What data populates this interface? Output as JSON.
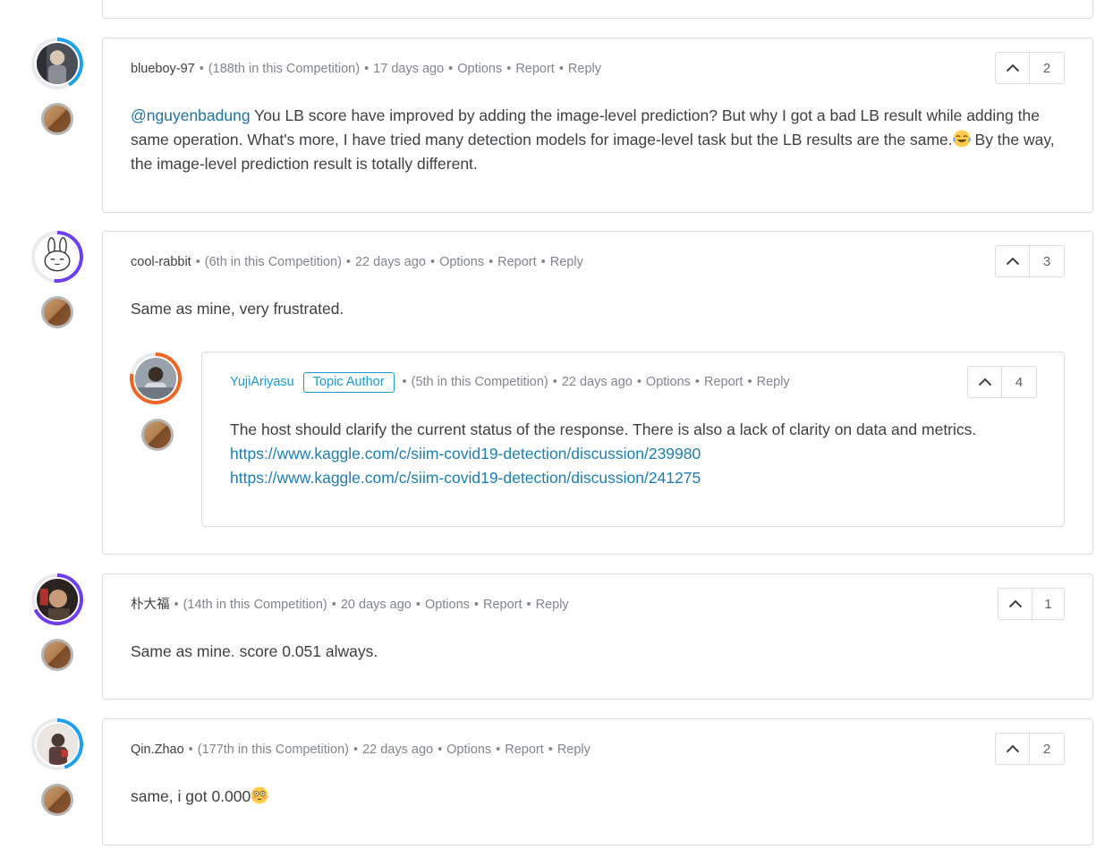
{
  "comments": [
    {
      "author": "blueboy-97",
      "rank": "(188th in this Competition)",
      "age": "17 days ago",
      "options": "Options",
      "report": "Report",
      "reply": "Reply",
      "votes": "2",
      "mention": "@nguyenbadung",
      "text_1": "You LB score have improved by adding the image-level prediction? But why I got a bad LB result while adding the same operation. What's more, I have tried many detection models for image-level task but the LB results are the same.",
      "emoji_1": "laughing-tears-emoji",
      "text_2": "By the way, the image-level prediction result is totally different."
    },
    {
      "author": "cool-rabbit",
      "rank": "(6th in this Competition)",
      "age": "22 days ago",
      "options": "Options",
      "report": "Report",
      "reply": "Reply",
      "votes": "3",
      "text": "Same as mine, very frustrated.",
      "reply_comment": {
        "author": "YujiAriyasu",
        "badge": "Topic Author",
        "rank": "(5th in this Competition)",
        "age": "22 days ago",
        "options": "Options",
        "report": "Report",
        "reply": "Reply",
        "votes": "4",
        "text": "The host should clarify the current status of the response. There is also a lack of clarity on data and metrics.",
        "links": [
          "https://www.kaggle.com/c/siim-covid19-detection/discussion/239980",
          "https://www.kaggle.com/c/siim-covid19-detection/discussion/241275"
        ]
      }
    },
    {
      "author": "朴大福",
      "rank": "(14th in this Competition)",
      "age": "20 days ago",
      "options": "Options",
      "report": "Report",
      "reply": "Reply",
      "votes": "1",
      "text": "Same as mine. score 0.051 always."
    },
    {
      "author": "Qin.Zhao",
      "rank": "(177th in this Competition)",
      "age": "22 days ago",
      "options": "Options",
      "report": "Report",
      "reply": "Reply",
      "votes": "2",
      "text": "same, i got 0.000",
      "emoji": "flushed-face-emoji"
    }
  ],
  "colors": {
    "link": "#1a7fb5",
    "tier_ring_blue": "#1ea0ea",
    "tier_ring_purple": "#6e3ef0",
    "tier_ring_orange": "#f06423",
    "medal_bronze": "#a0673c"
  },
  "icons": {
    "upvote": "chevron-up-icon",
    "medal": "bronze-medal-icon"
  }
}
